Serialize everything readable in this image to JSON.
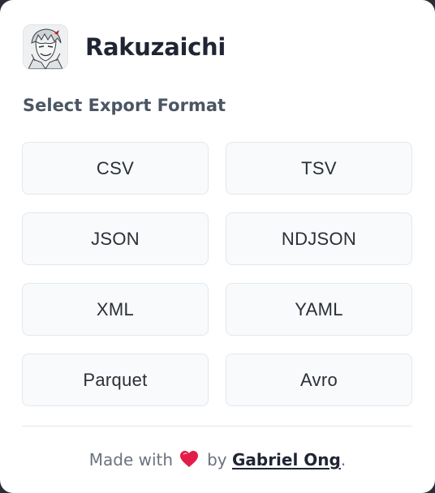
{
  "app": {
    "title": "Rakuzaichi",
    "avatar_icon": "manga-character-avatar-icon"
  },
  "export": {
    "heading": "Select Export Format",
    "formats": [
      "CSV",
      "TSV",
      "JSON",
      "NDJSON",
      "XML",
      "YAML",
      "Parquet",
      "Avro"
    ]
  },
  "footer": {
    "prefix": "Made with",
    "heart_icon": "heart-icon",
    "by": "by",
    "author": "Gabriel Ong",
    "suffix": "."
  },
  "colors": {
    "heart": "#e11d48",
    "button_bg": "#f8fafc",
    "button_border": "#e3e8ee",
    "title": "#1f2533",
    "muted": "#6b7280"
  }
}
